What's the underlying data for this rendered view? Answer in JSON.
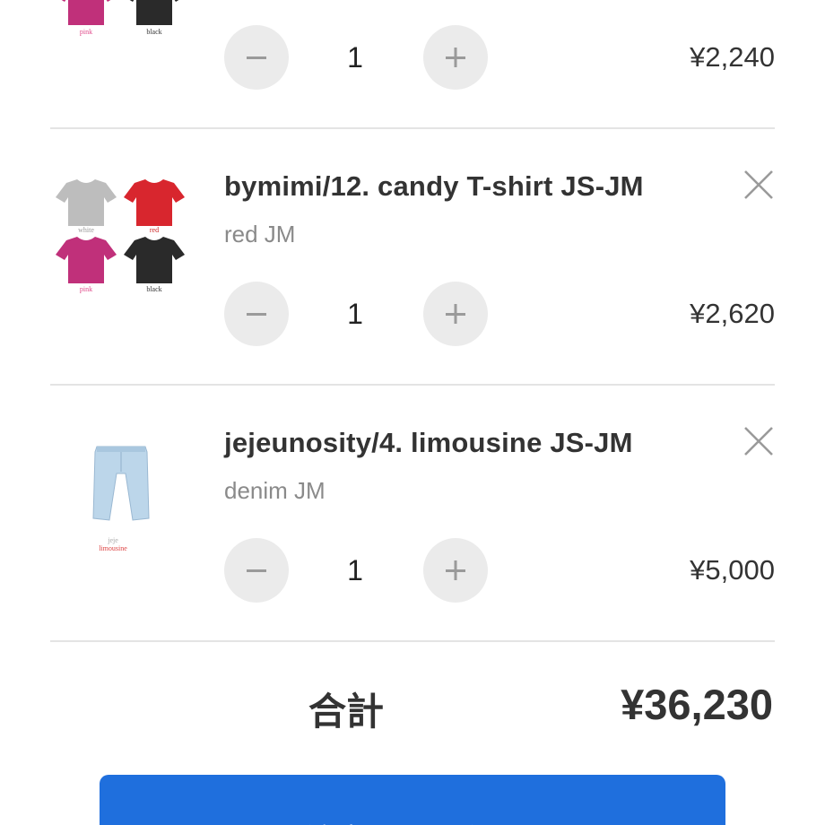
{
  "cart": {
    "items": [
      {
        "title": "",
        "variant": "",
        "quantity": "1",
        "price": "¥2,240",
        "image_captions": [
          "pink",
          "black"
        ]
      },
      {
        "title": "bymimi/12. candy T-shirt JS-JM",
        "variant": "red JM",
        "quantity": "1",
        "price": "¥2,620",
        "image_captions": [
          "white",
          "red",
          "pink",
          "black"
        ]
      },
      {
        "title": "jejeunosity/4. limousine JS-JM",
        "variant": "denim JM",
        "quantity": "1",
        "price": "¥5,000",
        "image_captions": [
          "jeje",
          "limousine"
        ]
      }
    ],
    "icons": {
      "decrement": "minus-icon",
      "increment": "plus-icon",
      "remove": "close-icon"
    }
  },
  "summary": {
    "total_label": "合計",
    "total_value": "¥36,230"
  },
  "checkout": {
    "label": "注文画面へ進む",
    "color": "#1f6fdd"
  },
  "colors": {
    "pink_shirt": "#c0307a",
    "black_shirt": "#2a2a2a",
    "gray_shirt": "#bdbdbd",
    "red_shirt": "#d8262e",
    "denim": "#bcd6ea",
    "qty_button_bg": "#ebebeb"
  }
}
